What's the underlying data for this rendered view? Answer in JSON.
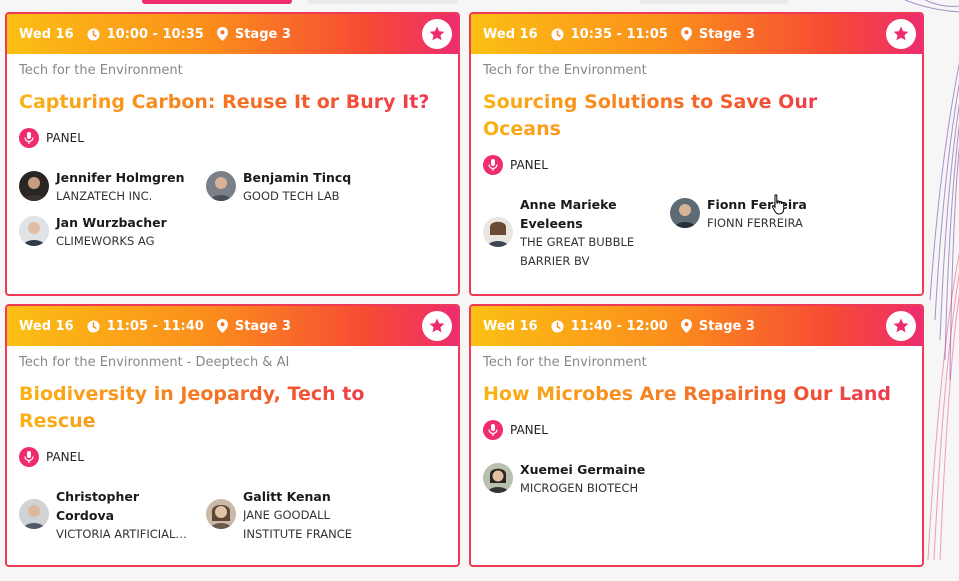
{
  "colors": {
    "accent": "#ee2c6f",
    "gradient_start": "#fbbf13",
    "gradient_end": "#ee2c6f",
    "track_text": "#888888"
  },
  "sessions": [
    {
      "day": "Wed 16",
      "time": "10:00 - 10:35",
      "stage": "Stage 3",
      "track": "Tech for the Environment",
      "track_extra": "",
      "title": "Capturing Carbon: Reuse It or Bury It?",
      "format": "PANEL",
      "speakers": [
        {
          "name": "Jennifer Holmgren",
          "org": "LANZATECH INC."
        },
        {
          "name": "Benjamin Tincq",
          "org": "GOOD TECH LAB"
        },
        {
          "name": "Jan Wurzbacher",
          "org": "CLIMEWORKS AG"
        }
      ]
    },
    {
      "day": "Wed 16",
      "time": "10:35 - 11:05",
      "stage": "Stage 3",
      "track": "Tech for the Environment",
      "track_extra": "",
      "title": "Sourcing Solutions to Save Our Oceans",
      "format": "PANEL",
      "speakers": [
        {
          "name": "Anne Marieke Eveleens",
          "org": "THE GREAT BUBBLE BARRIER BV"
        },
        {
          "name": "Fionn Ferreira",
          "org": "FIONN FERREIRA"
        }
      ]
    },
    {
      "day": "Wed 16",
      "time": "11:05 - 11:40",
      "stage": "Stage 3",
      "track": "Tech for the Environment",
      "track_extra": "Deeptech & AI",
      "title": "Biodiversity in Jeopardy, Tech to Rescue",
      "format": "PANEL",
      "speakers": [
        {
          "name": "Christopher Cordova",
          "org": "VICTORIA ARTIFICIAL…"
        },
        {
          "name": "Galitt Kenan",
          "org": "JANE GOODALL INSTITUTE FRANCE"
        }
      ]
    },
    {
      "day": "Wed 16",
      "time": "11:40 - 12:00",
      "stage": "Stage 3",
      "track": "Tech for the Environment",
      "track_extra": "",
      "title": "How Microbes Are Repairing Our Land",
      "format": "PANEL",
      "speakers": [
        {
          "name": "Xuemei Germaine",
          "org": "MICROGEN BIOTECH"
        }
      ]
    }
  ]
}
